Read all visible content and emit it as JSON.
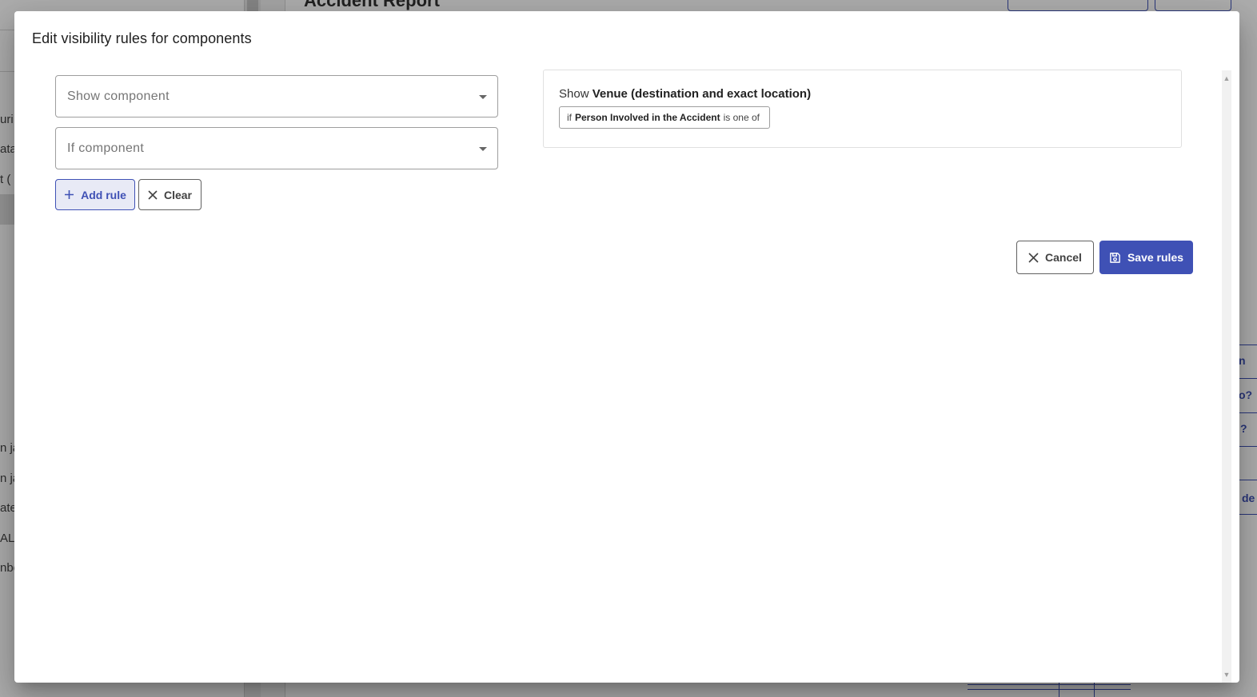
{
  "background": {
    "page_title": "Accident Report",
    "sidebar_fragments": [
      "uri",
      "ata",
      "t (",
      "n ja",
      "n ja",
      "ate",
      "AL",
      "nbo"
    ],
    "right_fragments": [
      "n",
      "o?",
      "?",
      "de"
    ]
  },
  "dialog": {
    "title": "Edit visibility rules for components",
    "show_component": {
      "placeholder": "Show component"
    },
    "if_component": {
      "placeholder": "If component"
    },
    "add_rule_label": "Add rule",
    "clear_label": "Clear",
    "cancel_label": "Cancel",
    "save_label": "Save rules",
    "rule": {
      "show_prefix": "Show",
      "target": "Venue (destination and exact location)",
      "condition_prefix": "if",
      "condition_component": "Person Involved in the Accident",
      "condition_operator": "is one of"
    }
  },
  "icons": {
    "add": "plus-icon",
    "clear": "close-icon",
    "cancel": "close-icon",
    "save": "floppy-disk-icon",
    "dropdown": "caret-down-icon"
  },
  "colors": {
    "primary": "#3f51b5",
    "primary_light": "#e8eaf6",
    "overlay": "rgba(0,0,0,0.32)"
  }
}
